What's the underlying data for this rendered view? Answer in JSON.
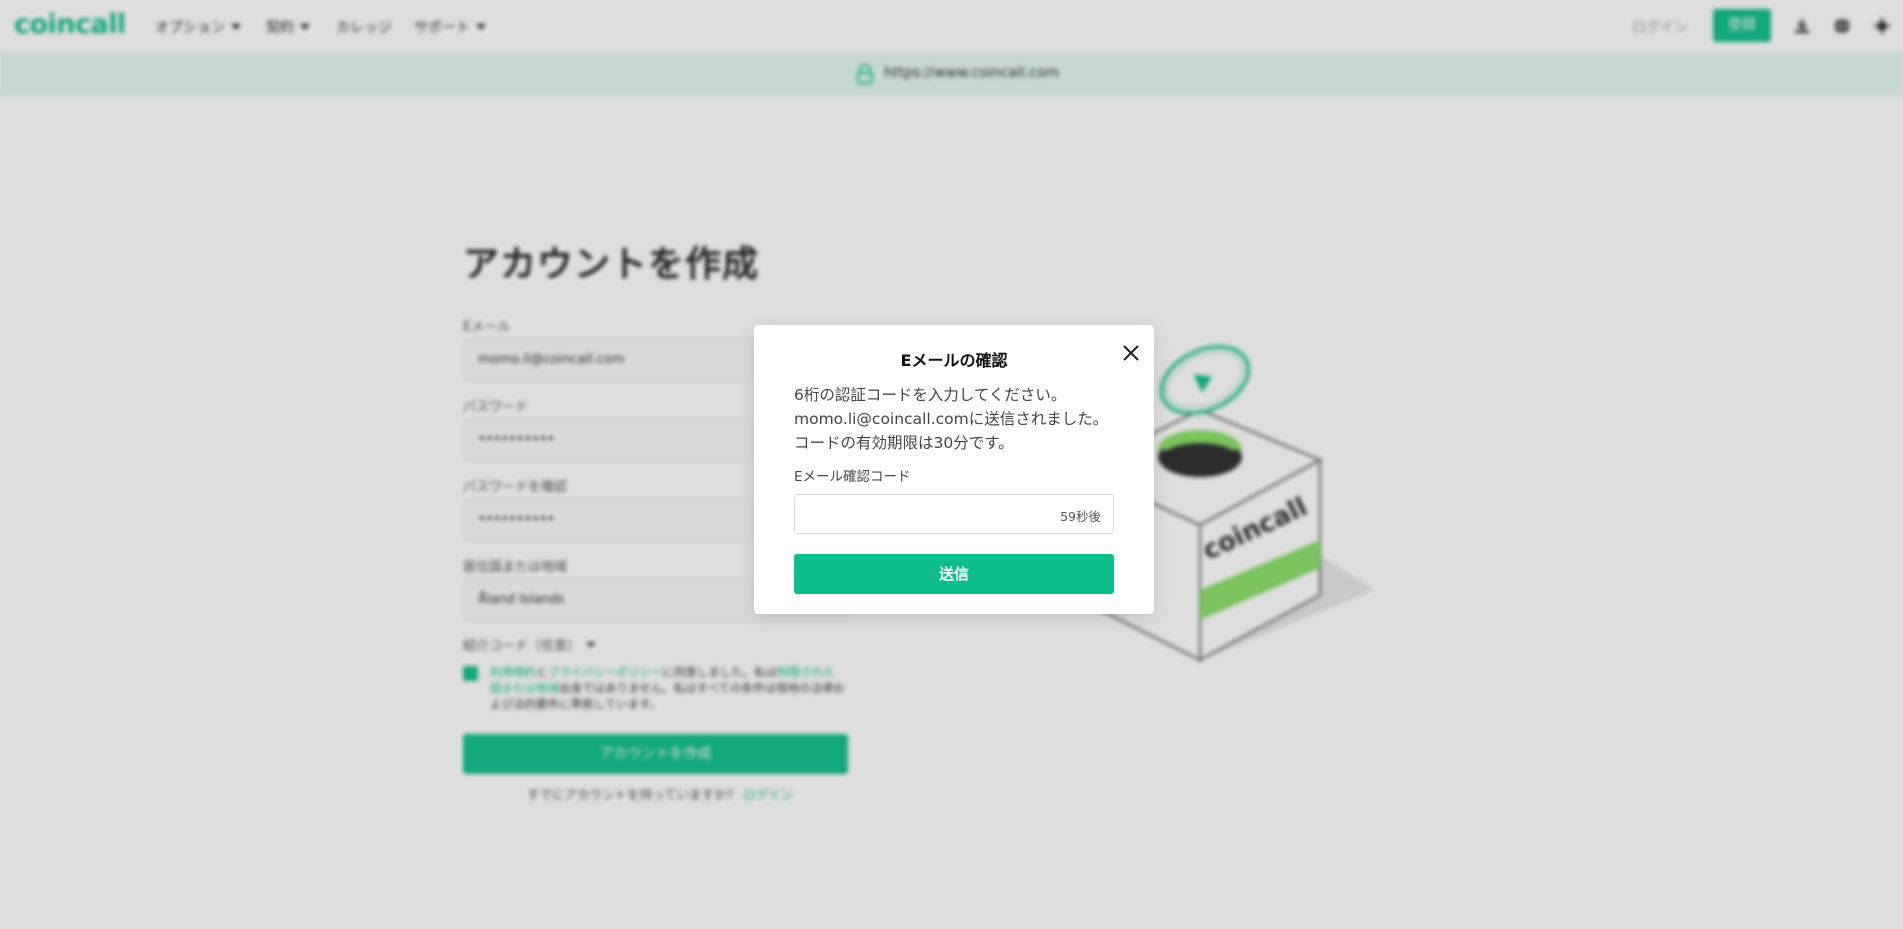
{
  "colors": {
    "accent": "#0dbd8b",
    "banner_bg": "#e4f8f1",
    "overlay": "rgba(0,0,0,0.13)"
  },
  "nav": {
    "logo": "coincall",
    "items": [
      {
        "label": "オプション",
        "has_caret": true
      },
      {
        "label": "契約",
        "has_caret": true
      },
      {
        "label": "カレッジ",
        "has_caret": false
      },
      {
        "label": "サポート",
        "has_caret": true
      }
    ],
    "login": "ログイン",
    "register": "登録",
    "icons": [
      "download-icon",
      "globe-icon",
      "theme-icon"
    ]
  },
  "banner": {
    "url": "https://www.coincall.com",
    "icon": "lock-icon"
  },
  "form": {
    "title": "アカウントを作成",
    "email_label": "Eメール",
    "email_value": "momo.li@coincall.com",
    "password_label": "パスワード",
    "password_value": "••••••••••",
    "confirm_label": "パスワードを確認",
    "confirm_value": "••••••••••",
    "country_label": "居住国または地域",
    "country_value": "Åland Islands",
    "referral_label": "紹介コード（任意）",
    "terms_link1": "利用規約",
    "terms_and": "と",
    "terms_link2": "プライバシーポリシー",
    "terms_text1": "に同意しました。私は",
    "terms_link3": "制限された国または地域",
    "terms_text2": "出身ではありません。私はすべての条件は現地の法律および法的要件に準拠しています。",
    "create_button": "アカウントを作成",
    "have_account": "すでにアカウントを持っていますか?",
    "login_link": "ログイン"
  },
  "modal": {
    "title": "Eメールの確認",
    "message_line1": "6桁の認証コードを入力してください。",
    "message_line2": "momo.li@coincall.comに送信されました。",
    "message_line3": "コードの有効期限は30分です。",
    "code_label": "Eメール確認コード",
    "code_value": "",
    "countdown": "59秒後",
    "send_button": "送信"
  }
}
